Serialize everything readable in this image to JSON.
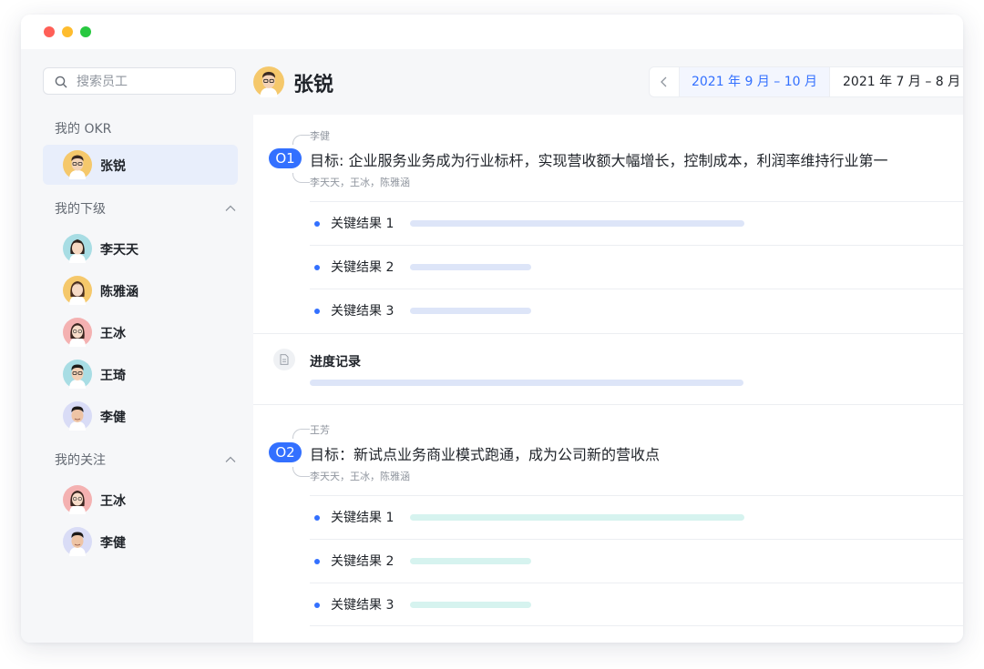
{
  "search": {
    "placeholder": "搜索员工"
  },
  "sidebar": {
    "my_okr_label": "我的 OKR",
    "self": {
      "name": "张锐"
    },
    "subordinates_label": "我的下级",
    "subordinates": [
      {
        "name": "李天天"
      },
      {
        "name": "陈雅涵"
      },
      {
        "name": "王冰"
      },
      {
        "name": "王琦"
      },
      {
        "name": "李健"
      }
    ],
    "following_label": "我的关注",
    "following": [
      {
        "name": "王冰"
      },
      {
        "name": "李健"
      }
    ]
  },
  "header": {
    "title": "张锐",
    "current_period": "2021 年 9 月 – 10 月",
    "other_period": "2021 年 7 月 – 8 月"
  },
  "objectives": [
    {
      "owner": "李健",
      "badge": "O1",
      "title": "目标: 企业服务业务成为行业标杆，实现营收额大幅增长，控制成本，利润率维持行业第一",
      "members": "李天天，王冰，陈雅涵",
      "key_results": [
        {
          "label": "关键结果 1",
          "progress": 0.77
        },
        {
          "label": "关键结果 2",
          "progress": 0.28
        },
        {
          "label": "关键结果 3",
          "progress": 0.28
        }
      ],
      "log_title": "进度记录"
    },
    {
      "owner": "王芳",
      "badge": "O2",
      "title": "目标：新试点业务商业模式跑通，成为公司新的营收点",
      "members": "李天天，王冰，陈雅涵",
      "key_results": [
        {
          "label": "关键结果 1",
          "progress": 0.77
        },
        {
          "label": "关键结果 2",
          "progress": 0.28
        },
        {
          "label": "关键结果 3",
          "progress": 0.28
        }
      ]
    }
  ],
  "colors": {
    "accent": "#3370ff",
    "active_bg": "#e8eefb",
    "bar_blue": "#dde5f8",
    "bar_green": "#d6f3ef"
  }
}
